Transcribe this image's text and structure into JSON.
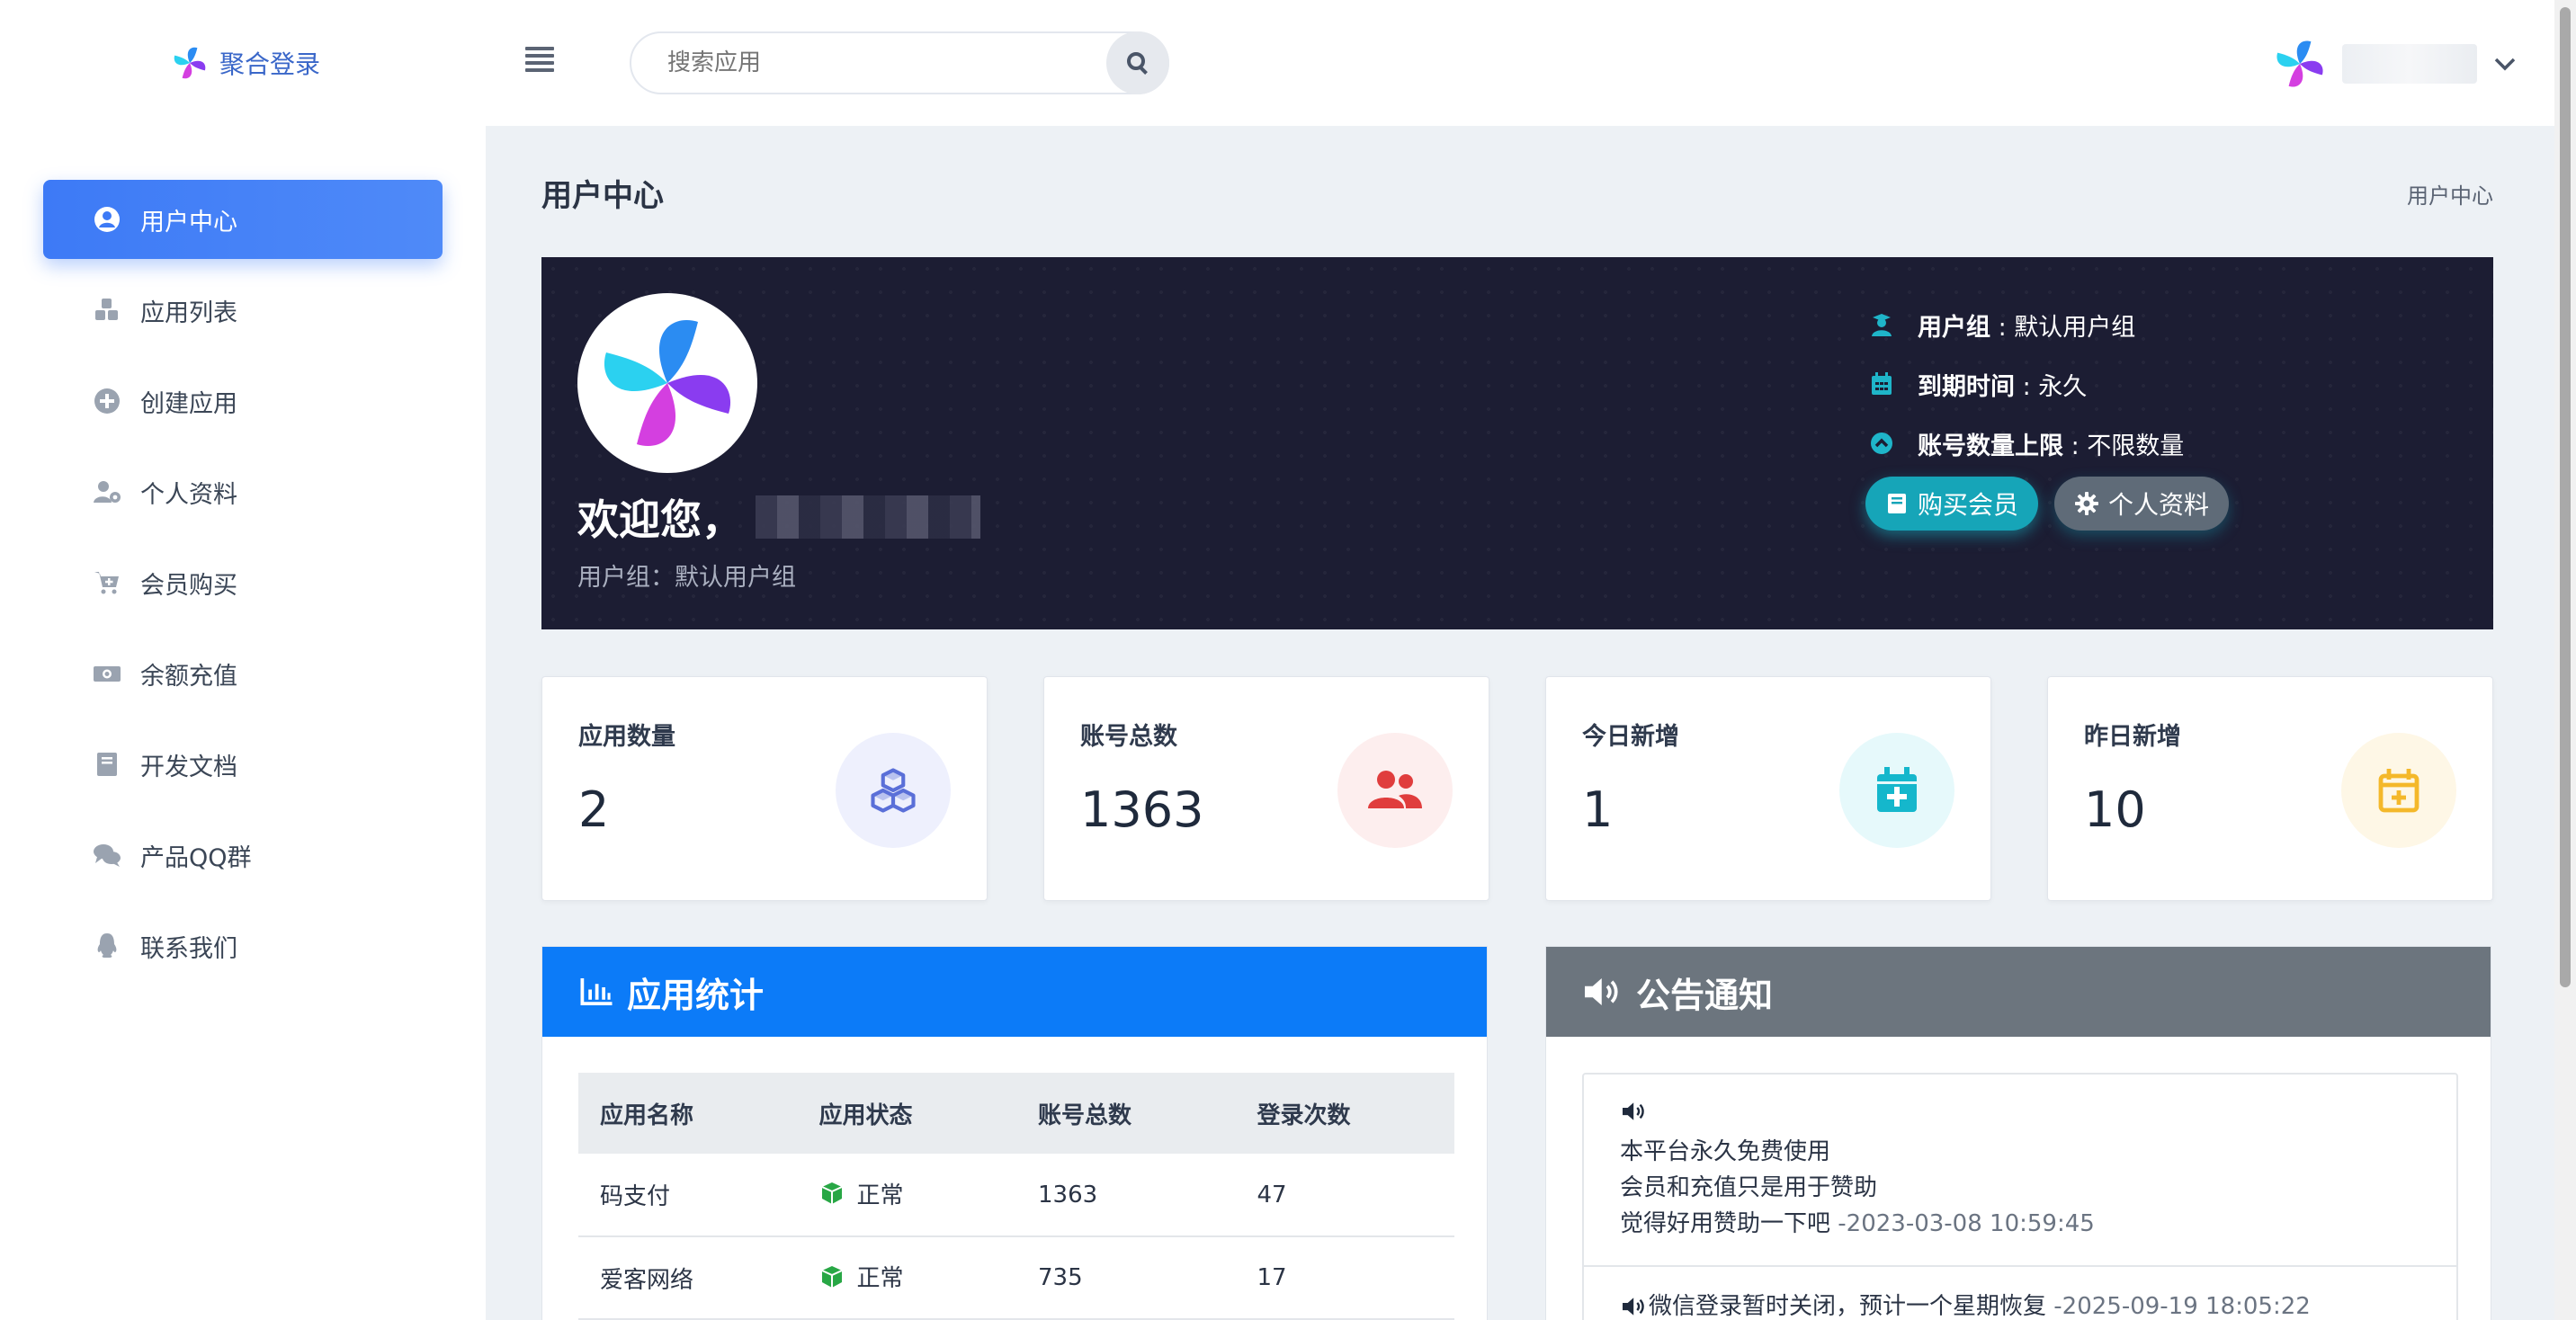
{
  "brand": {
    "name": "聚合登录"
  },
  "search": {
    "placeholder": "搜索应用"
  },
  "sidebar": {
    "items": [
      {
        "label": "用户中心",
        "icon": "user-circle-icon",
        "active": true
      },
      {
        "label": "应用列表",
        "icon": "cubes-icon"
      },
      {
        "label": "创建应用",
        "icon": "plus-circle-icon"
      },
      {
        "label": "个人资料",
        "icon": "user-cog-icon"
      },
      {
        "label": "会员购买",
        "icon": "cart-icon"
      },
      {
        "label": "余额充值",
        "icon": "money-icon"
      },
      {
        "label": "开发文档",
        "icon": "book-icon"
      },
      {
        "label": "产品QQ群",
        "icon": "comments-icon"
      },
      {
        "label": "联系我们",
        "icon": "qq-icon"
      }
    ]
  },
  "page": {
    "title": "用户中心",
    "breadcrumb": "用户中心"
  },
  "hero": {
    "welcome": "欢迎您，",
    "group_line": "用户组：默认用户组",
    "info": [
      {
        "label": "用户组",
        "value": " : 默认用户组",
        "icon": "user-graduate-icon"
      },
      {
        "label": "到期时间",
        "value": " : 永久",
        "icon": "calendar-icon"
      },
      {
        "label": "账号数量上限",
        "value": " : 不限数量",
        "icon": "chevron-up-circle-icon"
      }
    ],
    "buttons": {
      "buy": "购买会员",
      "profile": "个人资料"
    }
  },
  "stats": [
    {
      "label": "应用数量",
      "value": "2",
      "icon": "cubes-icon",
      "color": "#5a6fd8"
    },
    {
      "label": "账号总数",
      "value": "1363",
      "icon": "users-icon",
      "color": "#e03d3d"
    },
    {
      "label": "今日新增",
      "value": "1",
      "icon": "calendar-plus-icon",
      "color": "#15b7cc"
    },
    {
      "label": "昨日新增",
      "value": "10",
      "icon": "calendar-plus-icon",
      "color": "#f4b82a"
    }
  ],
  "app_stats": {
    "title": "应用统计",
    "columns": [
      "应用名称",
      "应用状态",
      "账号总数",
      "登录次数"
    ],
    "rows": [
      {
        "name": "码支付",
        "status": "正常",
        "accounts": "1363",
        "logins": "47"
      },
      {
        "name": "爱客网络",
        "status": "正常",
        "accounts": "735",
        "logins": "17"
      }
    ]
  },
  "notices": {
    "title": "公告通知",
    "items": [
      {
        "lines": [
          "本平台永久免费使用",
          "会员和充值只是用于赞助",
          "觉得好用赞助一下吧"
        ],
        "date": " -2023-03-08 10:59:45"
      },
      {
        "lines": [
          "微信登录暂时关闭，预计一个星期恢复"
        ],
        "date": " -2025-09-19 18:05:22"
      }
    ]
  }
}
